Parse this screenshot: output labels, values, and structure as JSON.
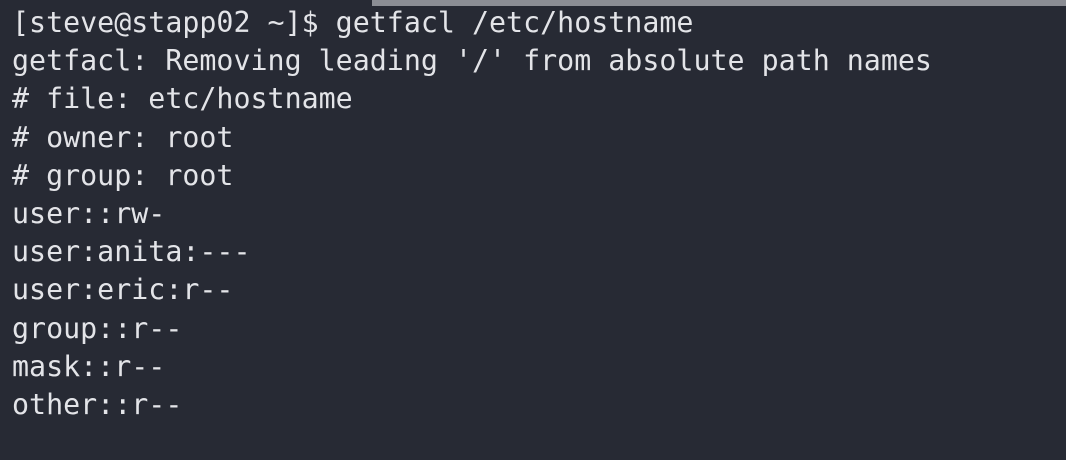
{
  "terminal": {
    "lines": [
      "[steve@stapp02 ~]$ getfacl /etc/hostname",
      "getfacl: Removing leading '/' from absolute path names",
      "# file: etc/hostname",
      "# owner: root",
      "# group: root",
      "user::rw-",
      "user:anita:---",
      "user:eric:r--",
      "group::r--",
      "mask::r--",
      "other::r--"
    ]
  }
}
